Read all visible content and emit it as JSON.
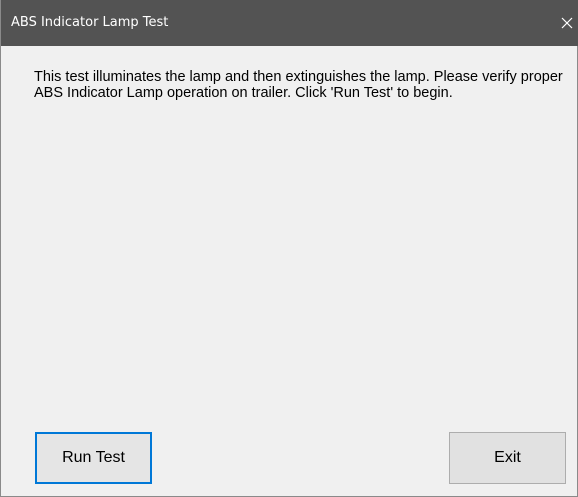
{
  "window": {
    "title": "ABS Indicator Lamp Test",
    "close_icon": "close-icon",
    "titlebar_color": "#535353",
    "background_color": "#f0f0f0"
  },
  "dialog": {
    "message": "This test illuminates the lamp and then extinguishes the lamp. Please verify proper ABS Indicator Lamp operation on trailer. Click 'Run Test' to begin."
  },
  "buttons": {
    "run_test_label": "Run Test",
    "exit_label": "Exit",
    "focus_color": "#0078d7"
  }
}
